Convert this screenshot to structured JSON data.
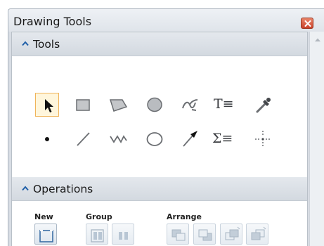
{
  "window": {
    "title": "Drawing Tools"
  },
  "sections": {
    "tools": {
      "label": "Tools"
    },
    "operations": {
      "label": "Operations"
    }
  },
  "tools": [
    {
      "name": "select",
      "icon": "arrow-pointer-icon",
      "selected": true
    },
    {
      "name": "rectangle",
      "icon": "rectangle-icon"
    },
    {
      "name": "polygon",
      "icon": "polygon-icon"
    },
    {
      "name": "ellipse-filled",
      "icon": "filled-ellipse-icon"
    },
    {
      "name": "freehand",
      "icon": "freehand-icon"
    },
    {
      "name": "text",
      "icon": "text-icon",
      "label": "T≡"
    },
    {
      "name": "eyedropper",
      "icon": "eyedropper-icon"
    },
    {
      "name": "point",
      "icon": "point-icon"
    },
    {
      "name": "line",
      "icon": "line-icon"
    },
    {
      "name": "polyline",
      "icon": "polyline-icon"
    },
    {
      "name": "ellipse-outline",
      "icon": "ellipse-outline-icon"
    },
    {
      "name": "arrow",
      "icon": "arrow-line-icon"
    },
    {
      "name": "equation",
      "icon": "sigma-icon",
      "label": "Σ≡"
    },
    {
      "name": "crosshair",
      "icon": "crosshair-icon"
    }
  ],
  "operations": {
    "new_label": "New",
    "group_label": "Group",
    "arrange_label": "Arrange"
  },
  "colors": {
    "selected_border": "#f0b45a",
    "selected_fill": "#fff6dc",
    "icon_gray": "#6b6e72",
    "header_bg": "#dbe0e6",
    "close_red": "#d0543a"
  }
}
